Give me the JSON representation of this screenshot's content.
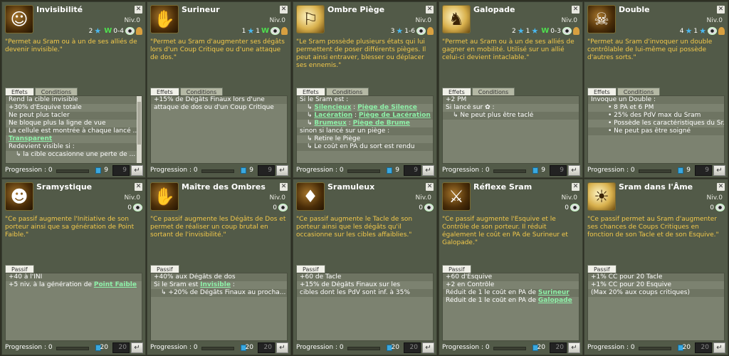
{
  "cards": [
    {
      "name": "Invisibilité",
      "niv": "Niv.0",
      "icon": "invisibility-icon",
      "glyph": "☺",
      "style": "dark",
      "costs": {
        "pa": "2",
        "pw": "W",
        "range": "0-4"
      },
      "desc": "\"Permet au Sram ou à un de ses alliés de devenir invisible.\"",
      "tabs": [
        "Effets",
        "Conditions"
      ],
      "rows": [
        {
          "t": "Rend la cible invisible"
        },
        {
          "t": "+30% d'Esquive totale"
        },
        {
          "t": "Ne peut plus tacler"
        },
        {
          "t": "Ne bloque plus la ligne de vue"
        },
        {
          "t": "La cellule est montrée à chaque lancé ..."
        },
        {
          "link": "Transparent"
        },
        {
          "t": "Redevient visible si :"
        },
        {
          "t": "↳ la cible occasionne une perte de ...",
          "i": 1
        }
      ],
      "prog": "Progression : 0",
      "max": "9",
      "lvl": "9"
    },
    {
      "name": "Surineur",
      "niv": "Niv.0",
      "icon": "backstab-dagger-icon",
      "glyph": "✋",
      "style": "dark",
      "costs": {
        "pa": "1",
        "pw": "1"
      },
      "desc": "\"Permet au Sram d'augmenter ses dégâts lors d'un Coup Critique ou d'une attaque de dos.\"",
      "tabs": [
        "Effets",
        "Conditions"
      ],
      "rows": [
        {
          "t": "+15% de Dégâts Finaux lors d'une"
        },
        {
          "t": "attaque de dos ou d'un Coup Critique"
        }
      ],
      "prog": "Progression : 0",
      "max": "9",
      "lvl": "9"
    },
    {
      "name": "Ombre Piège",
      "niv": "Niv.0",
      "icon": "trap-shadow-icon",
      "glyph": "⚐",
      "style": "light",
      "costs": {
        "pa": "3",
        "range": "1-6"
      },
      "desc": "\"Le Sram possède plusieurs états qui lui permettent de poser différents pièges. Il peut ainsi entraver, blesser ou déplacer ses ennemis.\"",
      "tabs": [
        "Effets",
        "Conditions"
      ],
      "rows": [
        {
          "t": "Si le Sram est :"
        },
        {
          "pre": "↳ ",
          "link": "Silencieux",
          "mid": " : ",
          "link2": "Piège de Silence",
          "i": 1
        },
        {
          "pre": "↳ ",
          "link": "Lacération",
          "mid": " : ",
          "link2": "Piège de Lacération",
          "i": 1
        },
        {
          "pre": "↳ ",
          "link": "Brumeux",
          "mid": " : ",
          "link2": "Piège de Brume",
          "i": 1
        },
        {
          "t": "sinon si lancé sur un piège :"
        },
        {
          "t": "↳ Retire le Piège",
          "i": 1
        },
        {
          "t": "↳ Le coût en PA du sort est rendu",
          "i": 1
        }
      ],
      "prog": "Progression : 0",
      "max": "9",
      "lvl": "9"
    },
    {
      "name": "Galopade",
      "niv": "Niv.0",
      "icon": "galop-runner-icon",
      "glyph": "♞",
      "style": "light",
      "costs": {
        "pa": "2",
        "pm": "1",
        "pw": "W",
        "range": "0-3"
      },
      "desc": "\"Permet au Sram ou à un de ses alliés de gagner en mobilité. Utilisé sur un allié celui-ci devient intaclable.\"",
      "tabs": [
        "Effets",
        "Conditions"
      ],
      "rows": [
        {
          "t": "+2 PM"
        },
        {
          "t": "Si lancé sur ✿ :"
        },
        {
          "t": "↳ Ne peut plus être taclé",
          "i": 1
        }
      ],
      "prog": "Progression : 0",
      "max": "9",
      "lvl": "9"
    },
    {
      "name": "Double",
      "niv": "Niv.0",
      "icon": "double-skull-icon",
      "glyph": "☠",
      "style": "dark",
      "costs": {
        "pa": "4",
        "pm": "1"
      },
      "desc": "\"Permet au Sram d'invoquer un double contrôlable de lui-même qui possède d'autres sorts.\"",
      "tabs": [
        "Effets",
        "Conditions"
      ],
      "rows": [
        {
          "t": "Invoque un Double :"
        },
        {
          "t": "• 8 PA et 6 PM",
          "i": 2
        },
        {
          "t": "• 25% des PdV max du Sram",
          "i": 2
        },
        {
          "t": "• Possède les caractéristiques du Sr...",
          "i": 2
        },
        {
          "t": "• Ne peut pas être soigné",
          "i": 2
        }
      ],
      "prog": "Progression : 0",
      "max": "9",
      "lvl": "9"
    },
    {
      "name": "Sramystique",
      "niv": "Niv.0",
      "icon": "sramystique-icon",
      "glyph": "☻",
      "style": "dark",
      "costs": {
        "num": "0"
      },
      "desc": "\"Ce passif augmente l'Initiative de son porteur ainsi que sa génération de Point Faible.\"",
      "tabs": [
        "Passif"
      ],
      "rows": [
        {
          "t": "+40 à l'INI"
        },
        {
          "pre": "+5 niv. à la génération de ",
          "link": "Point Faible"
        }
      ],
      "prog": "Progression : 0",
      "max": "20",
      "lvl": "20"
    },
    {
      "name": "Maître des Ombres",
      "niv": "Niv.0",
      "icon": "shadow-master-icon",
      "glyph": "✋",
      "style": "dark",
      "costs": {
        "num": "0"
      },
      "desc": "\"Ce passif augmente les Dégâts de Dos et permet de réaliser un coup brutal en sortant de l'invisibilité.\"",
      "tabs": [
        "Passif"
      ],
      "rows": [
        {
          "t": "+40% aux Dégâts de dos"
        },
        {
          "pre": "Si le Sram est ",
          "link": "Invisible",
          "mid": " :"
        },
        {
          "t": "↳ +20% de Dégâts Finaux au procha...",
          "i": 1
        }
      ],
      "prog": "Progression : 0",
      "max": "20",
      "lvl": "20"
    },
    {
      "name": "Sramuleux",
      "niv": "Niv.0",
      "icon": "sramuleux-icon",
      "glyph": "♦",
      "style": "dark",
      "costs": {
        "num": "0"
      },
      "desc": "\"Ce passif augmente le Tacle de son porteur ainsi que les dégâts qu'il occasionne sur les cibles affaiblies.\"",
      "tabs": [
        "Passif"
      ],
      "rows": [
        {
          "t": "+60 de Tacle"
        },
        {
          "t": "+15% de Dégâts Finaux sur les"
        },
        {
          "t": "cibles dont les PdV sont inf. à 35%"
        }
      ],
      "prog": "Progression : 0",
      "max": "20",
      "lvl": "20"
    },
    {
      "name": "Réflexe Sram",
      "niv": "Niv.0",
      "icon": "reflex-sram-icon",
      "glyph": "⚔",
      "style": "dark",
      "costs": {
        "num": "0"
      },
      "desc": "\"Ce passif augmente l'Esquive et le Contrôle de son porteur. Il réduit également le coût en PA de Surineur et Galopade.\"",
      "tabs": [
        "Passif"
      ],
      "rows": [
        {
          "t": "+60 d'Esquive"
        },
        {
          "t": "+2 en Contrôle"
        },
        {
          "pre": "Réduit de 1 le coût en PA de ",
          "link": "Surineur"
        },
        {
          "pre": "Réduit de 1 le coût en PA de ",
          "link": "Galopade"
        }
      ],
      "prog": "Progression : 0",
      "max": "20",
      "lvl": "20"
    },
    {
      "name": "Sram dans l'Âme",
      "niv": "Niv.0",
      "icon": "sram-soul-icon",
      "glyph": "☀",
      "style": "light",
      "costs": {
        "num": "0"
      },
      "desc": "\"Ce passif permet au Sram d'augmenter ses chances de Coups Critiques en fonction de son Tacle et de son Esquive.\"",
      "tabs": [
        "Passif"
      ],
      "rows": [
        {
          "t": "+1% CC pour 20 Tacle"
        },
        {
          "t": "+1% CC pour 20 Esquive"
        },
        {
          "t": "(Max 20% aux coups critiques)"
        }
      ],
      "prog": "Progression : 0",
      "max": "20",
      "lvl": "20"
    }
  ]
}
